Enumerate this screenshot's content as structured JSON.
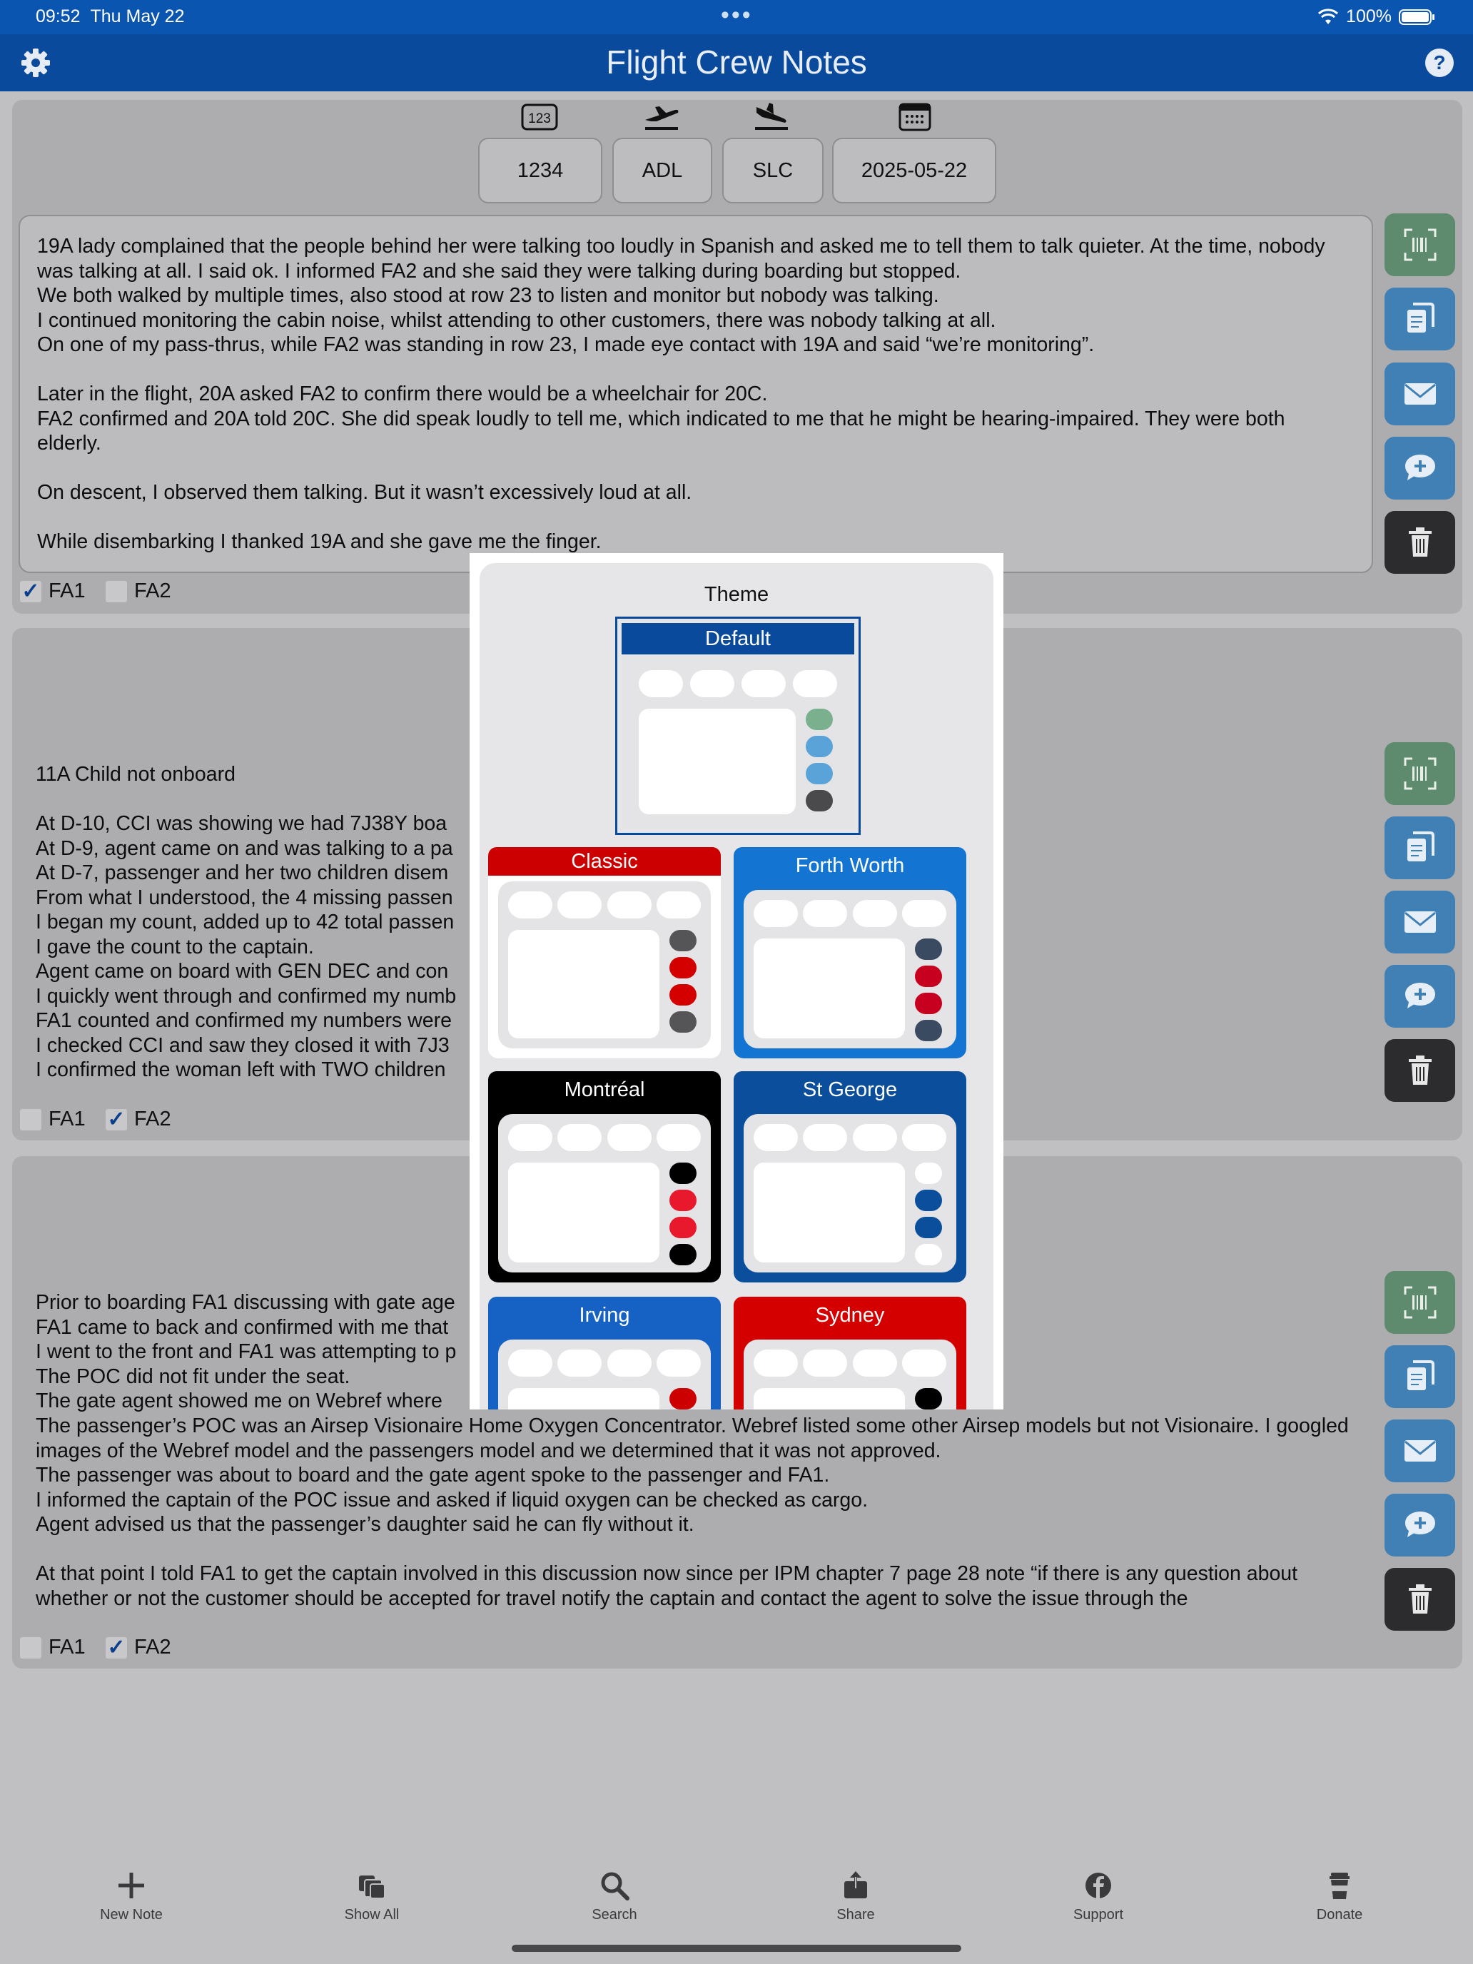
{
  "status_bar": {
    "time": "09:52",
    "date": "Thu May 22",
    "dots": "•••",
    "battery": "100%"
  },
  "nav": {
    "title": "Flight Crew Notes",
    "settings_icon": "gear-icon",
    "help_icon": "question-mark-icon"
  },
  "header": {
    "flight_number": "1234",
    "departure": "ADL",
    "arrival": "SLC",
    "date": "2025-05-22"
  },
  "notes": [
    {
      "text": "19A lady complained that the people behind her were talking too loudly in Spanish and asked me to tell them to talk quieter. At the time, nobody was talking at all. I said ok. I informed FA2 and she said they were talking during boarding but stopped.\nWe both walked by multiple times, also stood at row 23 to listen and monitor but nobody was talking.\nI continued monitoring the cabin noise, whilst attending to other customers, there was nobody talking at all.\nOn one of my pass-thrus, while FA2 was standing in row 23, I made eye contact with 19A and said “we’re monitoring”.\n\nLater in the flight, 20A asked FA2 to confirm there would be a wheelchair for 20C.\nFA2 confirmed and 20A told 20C. She did speak loudly to tell me, which indicated to me that he might be hearing-impaired. They were both elderly.\n\nOn descent, I observed them talking. But it wasn’t excessively loud at all.\n\nWhile disembarking I thanked 19A and she gave me the finger.",
      "fa1_label": "FA1",
      "fa1_checked": true,
      "fa2_label": "FA2",
      "fa2_checked": false
    },
    {
      "text": "11A Child not onboard\n\nAt D-10, CCI was showing we had 7J38Y boa\nAt D-9, agent came on and was talking to a pa\nAt D-7, passenger and her two children disem\nFrom what I understood, the 4 missing passen\nI began my count, added up to 42 total passen\nI gave the count to the captain.\nAgent came on board with GEN DEC and con\nI quickly went through and confirmed my numb\nFA1 counted and confirmed my numbers were\nI checked CCI and saw they closed it with 7J3\nI confirmed the woman left with TWO children",
      "fa1_label": "FA1",
      "fa1_checked": false,
      "fa2_label": "FA2",
      "fa2_checked": true
    },
    {
      "text_left": "Prior to boarding FA1 discussing with gate age\nFA1 came to back and confirmed with me that\nI went to the front and FA1 was attempting to p\nThe POC did not fit under the seat.\nThe gate agent showed me on Webref where",
      "text_full": "The passenger’s POC was an Airsep Visionaire Home Oxygen Concentrator. Webref listed some other Airsep models but not Visionaire. I googled images of the Webref model and the passengers model and we determined that it was not approved.\nThe passenger was about to board and the gate agent spoke to the passenger and FA1.\nI informed the captain of the POC issue and asked if liquid oxygen can be checked as cargo.\nAgent advised us that the passenger’s daughter said he can fly without it.\n\nAt that point I told FA1 to get the captain involved in this discussion now since per IPM chapter 7 page 28 note “if there is any question about whether or not the customer should be accepted for travel notify the captain and contact the agent to solve the issue through the",
      "fa1_label": "FA1",
      "fa1_checked": false,
      "fa2_label": "FA2",
      "fa2_checked": true
    }
  ],
  "side_actions": [
    "barcode-scan-icon",
    "copy-icon",
    "mail-icon",
    "add-comment-icon",
    "trash-icon"
  ],
  "theme_popup": {
    "title": "Theme",
    "themes": [
      {
        "name": "Default",
        "bar": "#0a4a9d",
        "frame": "#0a4a9d",
        "dots": [
          "#7bb08e",
          "#5aa3d8",
          "#5aa3d8",
          "#4a4a4c"
        ],
        "selected": true
      },
      {
        "name": "Classic",
        "bar": "#cc0000",
        "frame": "#ffffff",
        "dots": [
          "#555557",
          "#d40000",
          "#d40000",
          "#555557"
        ]
      },
      {
        "name": "Forth Worth",
        "bar": "#1374d2",
        "frame": "#1374d2",
        "dots": [
          "#3a4a60",
          "#c8001f",
          "#c8001f",
          "#3a4a60"
        ]
      },
      {
        "name": "Montréal",
        "bar": "#000000",
        "frame": "#000000",
        "dots": [
          "#000000",
          "#e8192c",
          "#e8192c",
          "#000000"
        ]
      },
      {
        "name": "St George",
        "bar": "#0b4f9c",
        "frame": "#0b4f9c",
        "dots": [
          "#ffffff",
          "#0b4f9c",
          "#0b4f9c",
          "#ffffff"
        ]
      },
      {
        "name": "Irving",
        "bar": "#1662c4",
        "frame": "#1662c4",
        "dots": [
          "#cc0000"
        ]
      },
      {
        "name": "Sydney",
        "bar": "#d40000",
        "frame": "#d40000",
        "dots": [
          "#000000",
          "#d40000"
        ]
      }
    ]
  },
  "tabs": [
    {
      "label": "New Note",
      "icon": "plus-icon"
    },
    {
      "label": "Show All",
      "icon": "stack-icon"
    },
    {
      "label": "Search",
      "icon": "search-icon"
    },
    {
      "label": "Share",
      "icon": "share-icon"
    },
    {
      "label": "Support",
      "icon": "facebook-icon"
    },
    {
      "label": "Donate",
      "icon": "coffee-cup-icon"
    }
  ]
}
